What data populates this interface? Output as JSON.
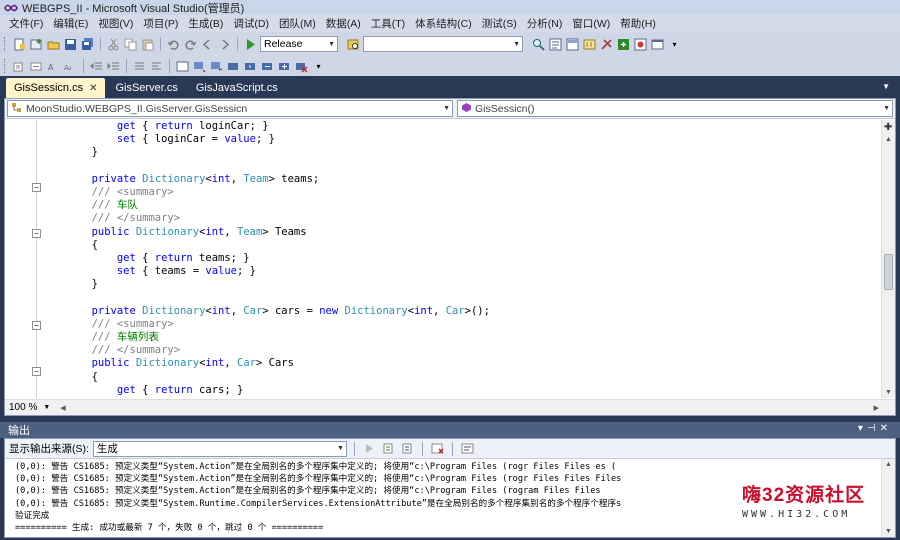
{
  "window": {
    "title": "WEBGPS_II - Microsoft Visual Studio(管理员)"
  },
  "menu": [
    "文件(F)",
    "编辑(E)",
    "视图(V)",
    "项目(P)",
    "生成(B)",
    "调试(D)",
    "团队(M)",
    "数据(A)",
    "工具(T)",
    "体系结构(C)",
    "测试(S)",
    "分析(N)",
    "窗口(W)",
    "帮助(H)"
  ],
  "toolbar": {
    "config_value": "Release",
    "platform_value": ""
  },
  "tabs": [
    {
      "label": "GisSessicn.cs",
      "active": true
    },
    {
      "label": "GisServer.cs",
      "active": false
    },
    {
      "label": "GisJavaScript.cs",
      "active": false
    }
  ],
  "editor": {
    "nav_left": "MoonStudio.WEBGPS_II.GisServer.GisSessicn",
    "nav_right": "GisSessicn()",
    "zoom": "100 %",
    "lines": [
      [
        {
          "t": "            "
        },
        {
          "t": "get",
          "c": "kw"
        },
        {
          "t": " { "
        },
        {
          "t": "return",
          "c": "kw"
        },
        {
          "t": " loginCar; }"
        }
      ],
      [
        {
          "t": "            "
        },
        {
          "t": "set",
          "c": "kw"
        },
        {
          "t": " { loginCar = "
        },
        {
          "t": "value",
          "c": "kw"
        },
        {
          "t": "; }"
        }
      ],
      [
        {
          "t": "        }"
        }
      ],
      [
        {
          "t": ""
        }
      ],
      [
        {
          "t": "        "
        },
        {
          "t": "private",
          "c": "kw"
        },
        {
          "t": " "
        },
        {
          "t": "Dictionary",
          "c": "ty"
        },
        {
          "t": "<"
        },
        {
          "t": "int",
          "c": "kw"
        },
        {
          "t": ", "
        },
        {
          "t": "Team",
          "c": "ty"
        },
        {
          "t": "> teams;"
        }
      ],
      [
        {
          "t": "        "
        },
        {
          "t": "/// <summary>",
          "c": "cmg"
        }
      ],
      [
        {
          "t": "        "
        },
        {
          "t": "/// ",
          "c": "cmg"
        },
        {
          "t": "车队",
          "c": "cm"
        }
      ],
      [
        {
          "t": "        "
        },
        {
          "t": "/// </summary>",
          "c": "cmg"
        }
      ],
      [
        {
          "t": "        "
        },
        {
          "t": "public",
          "c": "kw"
        },
        {
          "t": " "
        },
        {
          "t": "Dictionary",
          "c": "ty"
        },
        {
          "t": "<"
        },
        {
          "t": "int",
          "c": "kw"
        },
        {
          "t": ", "
        },
        {
          "t": "Team",
          "c": "ty"
        },
        {
          "t": "> Teams"
        }
      ],
      [
        {
          "t": "        {"
        }
      ],
      [
        {
          "t": "            "
        },
        {
          "t": "get",
          "c": "kw"
        },
        {
          "t": " { "
        },
        {
          "t": "return",
          "c": "kw"
        },
        {
          "t": " teams; }"
        }
      ],
      [
        {
          "t": "            "
        },
        {
          "t": "set",
          "c": "kw"
        },
        {
          "t": " { teams = "
        },
        {
          "t": "value",
          "c": "kw"
        },
        {
          "t": "; }"
        }
      ],
      [
        {
          "t": "        }"
        }
      ],
      [
        {
          "t": ""
        }
      ],
      [
        {
          "t": "        "
        },
        {
          "t": "private",
          "c": "kw"
        },
        {
          "t": " "
        },
        {
          "t": "Dictionary",
          "c": "ty"
        },
        {
          "t": "<"
        },
        {
          "t": "int",
          "c": "kw"
        },
        {
          "t": ", "
        },
        {
          "t": "Car",
          "c": "ty"
        },
        {
          "t": "> cars = "
        },
        {
          "t": "new",
          "c": "kw"
        },
        {
          "t": " "
        },
        {
          "t": "Dictionary",
          "c": "ty"
        },
        {
          "t": "<"
        },
        {
          "t": "int",
          "c": "kw"
        },
        {
          "t": ", "
        },
        {
          "t": "Car",
          "c": "ty"
        },
        {
          "t": ">();"
        }
      ],
      [
        {
          "t": "        "
        },
        {
          "t": "/// <summary>",
          "c": "cmg"
        }
      ],
      [
        {
          "t": "        "
        },
        {
          "t": "/// ",
          "c": "cmg"
        },
        {
          "t": "车辆列表",
          "c": "cm"
        }
      ],
      [
        {
          "t": "        "
        },
        {
          "t": "/// </summary>",
          "c": "cmg"
        }
      ],
      [
        {
          "t": "        "
        },
        {
          "t": "public",
          "c": "kw"
        },
        {
          "t": " "
        },
        {
          "t": "Dictionary",
          "c": "ty"
        },
        {
          "t": "<"
        },
        {
          "t": "int",
          "c": "kw"
        },
        {
          "t": ", "
        },
        {
          "t": "Car",
          "c": "ty"
        },
        {
          "t": "> Cars"
        }
      ],
      [
        {
          "t": "        {"
        }
      ],
      [
        {
          "t": "            "
        },
        {
          "t": "get",
          "c": "kw"
        },
        {
          "t": " { "
        },
        {
          "t": "return",
          "c": "kw"
        },
        {
          "t": " cars; }"
        }
      ]
    ]
  },
  "output": {
    "title": "输出",
    "source_label": "显示输出来源(S):",
    "source_value": "生成",
    "lines": [
      "(0,0): 警告 CS1685: 预定义类型“System.Action”是在全局别名的多个程序集中定义的; 将使用“c:\\Program Files (rogr Files Files es (",
      "(0,0): 警告 CS1685: 预定义类型“System.Action”是在全局别名的多个程序集中定义的; 将使用“c:\\Program Files (rogr Files Files Files",
      "(0,0): 警告 CS1685: 预定义类型“System.Action”是在全局别名的多个程序集中定义的; 将使用“c:\\Program Files (rogram Files Files",
      "(0,0): 警告 CS1685: 预定义类型“System.Runtime.CompilerServices.ExtensionAttribute”是在全局别名的多个程序集别名的多个程序个程序s",
      "验证完成",
      "========== 生成: 成功或最新 7 个，失败 0 个，跳过 0 个 =========="
    ]
  },
  "watermark": {
    "main": "嗨32资源社区",
    "sub": "WWW.HI32.COM"
  },
  "colors": {
    "chrome_dark": "#293955",
    "active_tab": "#fff4cc",
    "keyword": "#0000ff",
    "type": "#2b91af",
    "comment": "#008000"
  }
}
